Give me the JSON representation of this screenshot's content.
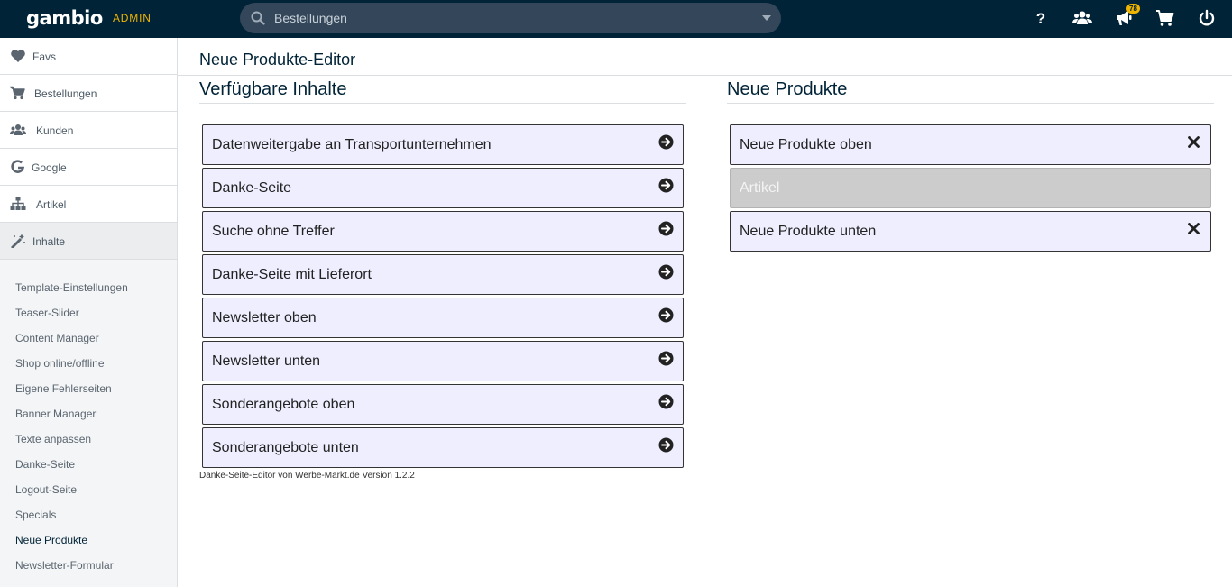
{
  "header": {
    "logo": "gambio",
    "admin_label": "ADMIN",
    "search_placeholder": "Bestellungen",
    "notification_count": "78"
  },
  "sidebar": {
    "items": [
      {
        "label": "Favs",
        "icon": "heart-icon"
      },
      {
        "label": "Bestellungen",
        "icon": "cart-icon"
      },
      {
        "label": "Kunden",
        "icon": "users-icon"
      },
      {
        "label": "Google",
        "icon": "google-icon"
      },
      {
        "label": "Artikel",
        "icon": "sitemap-icon"
      },
      {
        "label": "Inhalte",
        "icon": "magic-wand-icon"
      }
    ],
    "subitems": [
      "Template-Einstellungen",
      "Teaser-Slider",
      "Content Manager",
      "Shop online/offline",
      "Eigene Fehlerseiten",
      "Banner Manager",
      "Texte anpassen",
      "Danke-Seite",
      "Logout-Seite",
      "Specials",
      "Neue Produkte",
      "Newsletter-Formular"
    ],
    "active_subitem": "Neue Produkte"
  },
  "main": {
    "page_title": "Neue Produkte-Editor",
    "available": {
      "title": "Verfügbare Inhalte",
      "items": [
        "Datenweitergabe an Transportunternehmen",
        "Danke-Seite",
        "Suche ohne Treffer",
        "Danke-Seite mit Lieferort",
        "Newsletter oben",
        "Newsletter unten",
        "Sonderangebote oben",
        "Sonderangebote unten"
      ]
    },
    "selected": {
      "title": "Neue Produkte",
      "items": [
        {
          "label": "Neue Produkte oben",
          "removable": true
        },
        {
          "label": "Artikel",
          "removable": false
        },
        {
          "label": "Neue Produkte unten",
          "removable": true
        }
      ]
    },
    "footer_note": "Danke-Seite-Editor von Werbe-Markt.de Version 1.2.2"
  },
  "colors": {
    "topbar": "#002337",
    "accent": "#f0b400",
    "box_bg": "#eeeeff",
    "box_fixed_bg": "#cccccc"
  }
}
